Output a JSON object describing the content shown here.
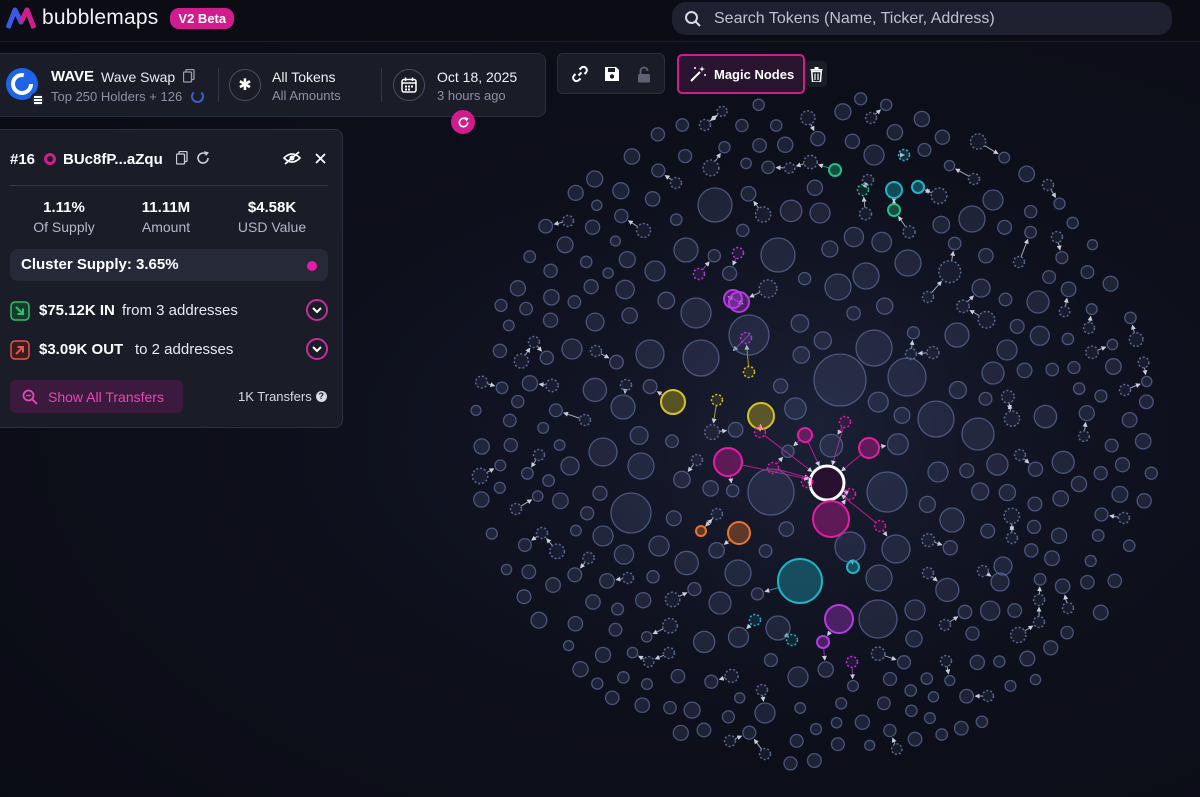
{
  "app": {
    "logo_text": "bubblemaps",
    "beta_badge": "V2 Beta",
    "search_placeholder": "Search Tokens (Name, Ticker, Address)"
  },
  "token": {
    "symbol": "WAVE",
    "name": "Wave Swap",
    "holders_label": "Top 250 Holders + 126"
  },
  "filter": {
    "main": "All Tokens",
    "sub": "All Amounts"
  },
  "date": {
    "main": "Oct 18, 2025",
    "sub": "3 hours ago"
  },
  "toolbar": {
    "magic_nodes_label": "Magic Nodes"
  },
  "holder_panel": {
    "rank": "#16",
    "address": "BUc8fP...aZqu",
    "stats": [
      {
        "value": "1.11%",
        "label": "Of Supply"
      },
      {
        "value": "11.11M",
        "label": "Amount"
      },
      {
        "value": "$4.58K",
        "label": "USD Value"
      }
    ],
    "cluster_supply": "Cluster Supply: 3.65%",
    "flow_in": {
      "amount": "$75.12K IN",
      "desc": "from 3 addresses"
    },
    "flow_out": {
      "amount": "$3.09K OUT",
      "desc": "to 2 addresses"
    },
    "show_transfers_label": "Show All Transfers",
    "transfers_count": "1K Transfers"
  },
  "colors": {
    "accent": "#d21c8e",
    "bubble_default": "#5b6a95",
    "cluster_magenta": "#e51ca6",
    "cluster_purple": "#b53be0",
    "cluster_yellow": "#d8c21f",
    "cluster_cyan": "#1fb4c8",
    "cluster_green": "#20c08a",
    "cluster_orange": "#e8752a",
    "flow_in": "#2fbf71",
    "flow_out": "#e0574f"
  },
  "icons": [
    "search-icon",
    "copy-icon",
    "asterisk-icon",
    "calendar-icon",
    "refresh-icon",
    "link-icon",
    "save-icon",
    "lock-icon",
    "magic-wand-icon",
    "trash-icon",
    "hide-icon",
    "close-icon",
    "arrow-in-icon",
    "arrow-out-icon",
    "chevron-down-icon",
    "transfers-search-icon",
    "help-icon"
  ]
}
